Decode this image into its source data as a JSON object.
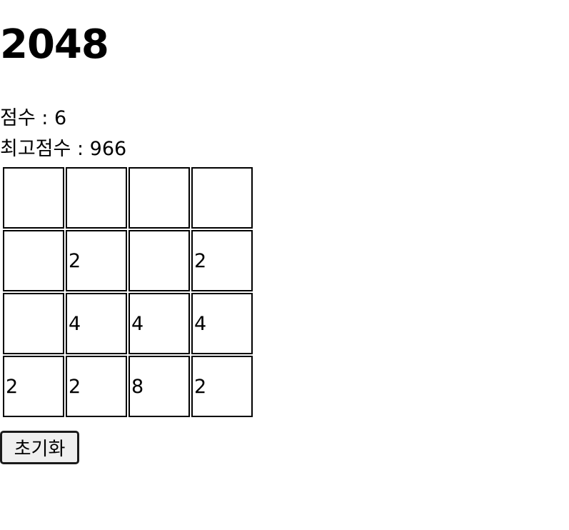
{
  "game": {
    "title": "2048"
  },
  "score": {
    "label": "점수",
    "separator": " : ",
    "value": "6"
  },
  "best_score": {
    "label": "최고점수",
    "separator": " : ",
    "value": "966"
  },
  "board": {
    "rows": [
      [
        "",
        "",
        "",
        ""
      ],
      [
        "",
        "2",
        "",
        "2"
      ],
      [
        "",
        "4",
        "4",
        "4"
      ],
      [
        "2",
        "2",
        "8",
        "2"
      ]
    ]
  },
  "reset_button": {
    "label": "초기화"
  }
}
